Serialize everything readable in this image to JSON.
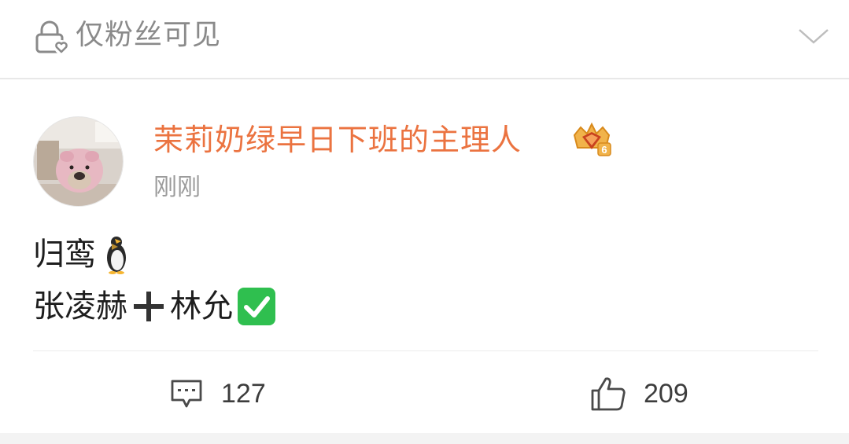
{
  "visibility": {
    "label": "仅粉丝可见",
    "icon": "lock-heart-icon",
    "toggle_icon": "chevron-down-icon"
  },
  "post": {
    "author": {
      "name": "茉莉奶绿早日下班的主理人",
      "name_color": "#eb7340",
      "badge": "vip-crown-icon",
      "badge_level": "6",
      "avatar": "avatar-pig-hat-dog"
    },
    "time": "刚刚",
    "content": {
      "line1_text": "归鸾",
      "line1_emoji": "penguin-icon",
      "line2_part1": "张凌赫",
      "line2_plus": "plus-icon",
      "line2_part2": "林允",
      "line2_emoji": "check-mark-icon"
    }
  },
  "actions": {
    "comments": {
      "icon": "comment-icon",
      "count": "127"
    },
    "likes": {
      "icon": "thumbs-up-icon",
      "count": "209"
    }
  },
  "colors": {
    "accent": "#eb7340",
    "muted": "#8a8a8a",
    "text": "#1e1e1e",
    "check_green": "#2fbf4f"
  }
}
